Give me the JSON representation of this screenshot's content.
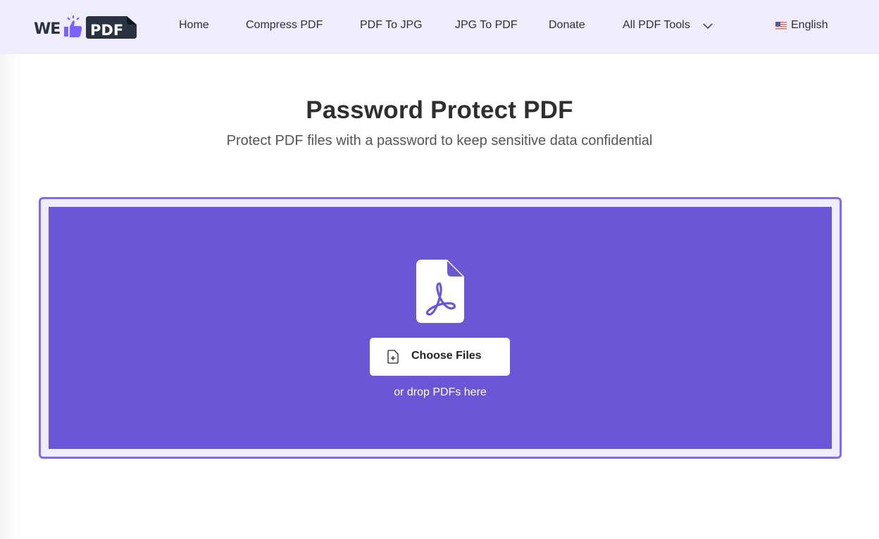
{
  "header": {
    "logo": {
      "left_text": "WE",
      "right_text": "PDF",
      "icon": "thumbs-up-icon"
    },
    "nav": [
      {
        "label": "Home"
      },
      {
        "label": "Compress PDF"
      },
      {
        "label": "PDF To JPG"
      },
      {
        "label": "JPG To PDF"
      },
      {
        "label": "Donate"
      },
      {
        "label": "All PDF Tools",
        "icon": "chevron-down-icon"
      }
    ],
    "language": {
      "label": "English",
      "icon": "us-flag-icon"
    }
  },
  "main": {
    "title": "Password Protect PDF",
    "subtitle": "Protect PDF files with a password to keep sensitive data confidential",
    "dropzone": {
      "icon": "pdf-file-icon",
      "button_label": "Choose Files",
      "button_icon": "file-plus-icon",
      "hint": "or drop PDFs here"
    }
  },
  "colors": {
    "header_bg": "#efedfd",
    "accent": "#6b56d6",
    "accent_border": "#8468f3"
  }
}
